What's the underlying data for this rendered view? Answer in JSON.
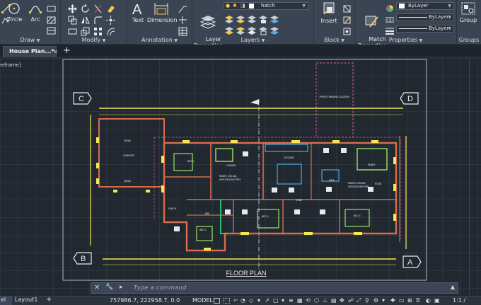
{
  "ribbon": {
    "draw": {
      "title": "Draw",
      "circle_label": "Circle",
      "arc_label": "Arc"
    },
    "modify": {
      "title": "Modify"
    },
    "annotation": {
      "title": "Annotation",
      "text_label": "Text",
      "dimension_label": "Dimension"
    },
    "layers": {
      "title": "Layers",
      "layer_properties_label": "Layer\nProperties",
      "current_layer": "hatch"
    },
    "block": {
      "title": "Block",
      "insert_label": "Insert"
    },
    "properties": {
      "title": "Properties",
      "match_properties_label": "Match\nProperties",
      "color_value": "ByLayer",
      "linetype_value": "ByLayer",
      "lineweight_value": "ByLayer"
    },
    "groups": {
      "title": "Groups",
      "group_label": "Group"
    }
  },
  "tabs": {
    "document_tab": "House Plan...*",
    "new_tab_symbol": "+"
  },
  "viewport": {
    "label": "reframe]"
  },
  "drawing": {
    "title": "FLOOR PLAN",
    "grid_markers": [
      "C",
      "D",
      "B",
      "A"
    ],
    "room_labels": [
      "BRAE",
      "CARPORT",
      "BRAE",
      "BED 1",
      "LOUNGE",
      "RAKED CEILING\nEXPOSED RAFTERS",
      "KITCHEN",
      "FAMILY",
      "DINE",
      "RAKED CEILING\nEXPOSED RAFTERS",
      "PORCH",
      "BED 2",
      "ENS",
      "ROBE",
      "BED 3",
      "BED 4",
      "ROBE",
      "FREESTANDING\nGAZEBO"
    ]
  },
  "command_line": {
    "placeholder": "Type a command"
  },
  "status_bar": {
    "model_tab": "el",
    "layout_tab": "Layout1",
    "add_symbol": "+",
    "coordinates": "757986.7, 222958.7, 0.0",
    "model_label": "MODEL",
    "scale": "1:1 /"
  }
}
